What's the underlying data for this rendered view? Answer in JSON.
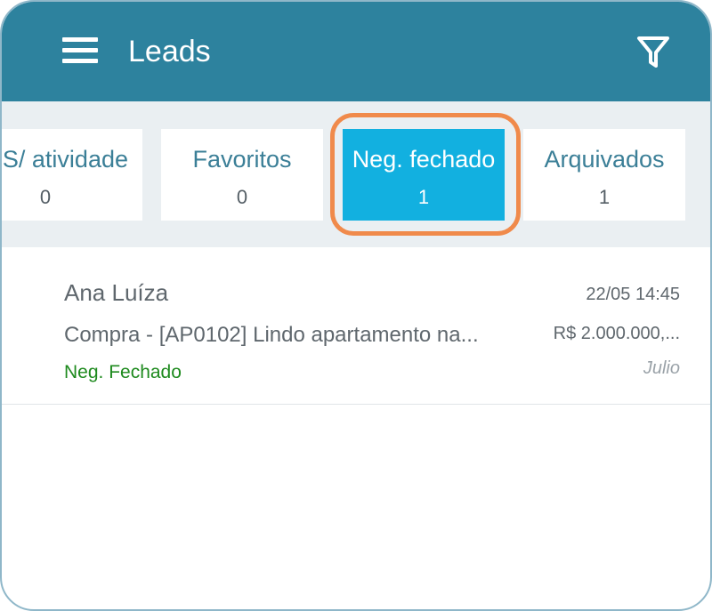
{
  "appbar": {
    "title": "Leads",
    "menu_icon": "menu-icon",
    "filter_icon": "filter-icon",
    "background_color": "#2d829e"
  },
  "tabs": [
    {
      "label": "S/ atividade",
      "count": "0",
      "active": false
    },
    {
      "label": "Favoritos",
      "count": "0",
      "active": false
    },
    {
      "label": "Neg. fechado",
      "count": "1",
      "active": true
    },
    {
      "label": "Arquivados",
      "count": "1",
      "active": false
    }
  ],
  "active_tab_color": "#12b0e0",
  "highlight_color": "#f08a4b",
  "leads": [
    {
      "name": "Ana Luíza",
      "subject": "Compra - [AP0102] Lindo apartamento na...",
      "status": "Neg. Fechado",
      "status_color": "#1e8a1e",
      "datetime": "22/05 14:45",
      "value": "R$ 2.000.000,...",
      "agent": "Julio"
    }
  ]
}
